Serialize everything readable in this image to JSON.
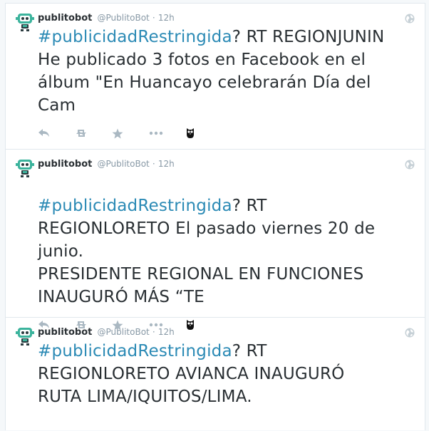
{
  "tweets": [
    {
      "fullname": "publitobot",
      "username": "@PublitoBot",
      "separator": "·",
      "time": "12h",
      "hashtag": "#publicidadRestringida",
      "text": "? RT REGIONJUNIN He publicado 3 fotos en Facebook en el álbum \"En Huancayo celebrarán Día del Cam",
      "icons": {
        "avatar": "robot-avatar",
        "globe": "globe-icon",
        "reply": "reply-icon",
        "retweet": "retweet-icon",
        "favorite": "star-icon",
        "more": "more-icon",
        "owl": "owl-icon"
      }
    },
    {
      "fullname": "publitobot",
      "username": "@PublitoBot",
      "separator": "·",
      "time": "12h",
      "hashtag": "#publicidadRestringida",
      "text": "? RT REGIONLORETO El pasado viernes 20 de junio.\nPRESIDENTE REGIONAL EN FUNCIONES INAUGURÓ MÁS “TE",
      "icons": {
        "avatar": "robot-avatar",
        "globe": "globe-icon",
        "reply": "reply-icon",
        "retweet": "retweet-icon",
        "favorite": "star-icon",
        "more": "more-icon",
        "owl": "owl-icon"
      }
    },
    {
      "fullname": "publitobot",
      "username": "@PublitoBot",
      "separator": "·",
      "time": "12h",
      "hashtag": "#publicidadRestringida",
      "text": "? RT REGIONLORETO AVIANCA INAUGURÓ RUTA LIMA/IQUITOS/LIMA.",
      "icons": {
        "avatar": "robot-avatar",
        "globe": "globe-icon"
      }
    }
  ],
  "colors": {
    "hashtag": "#2b8ab5",
    "text": "#292f33",
    "meta": "#8899a6",
    "action_icon": "#aab8c2",
    "border": "#e1e8ed",
    "avatar": "#3bb39c"
  }
}
